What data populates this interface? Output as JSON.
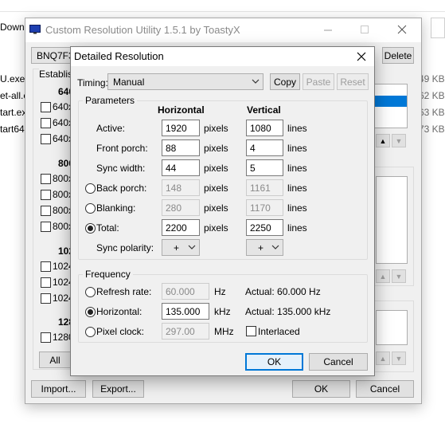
{
  "explorer": {
    "title_fragment": "Downlc",
    "files": [
      "U.exe",
      "et-all.e",
      "tart.ex",
      "tart64."
    ],
    "sizes": [
      "49 KB",
      "62 KB",
      "63 KB",
      "73 KB"
    ]
  },
  "main_window": {
    "title": "Custom Resolution Utility 1.5.1 by ToastyX",
    "monitor_combo": "BNQ7F33",
    "delete_label": "Delete",
    "established_label": "Establish",
    "res_group_a": "640",
    "res_list_a": [
      "640x",
      "640x",
      "640x"
    ],
    "res_group_b": "800",
    "res_list_b": [
      "800x",
      "800x",
      "800x",
      "800x"
    ],
    "res_group_c": "102",
    "res_list_c": [
      "1024",
      "1024",
      "1024"
    ],
    "res_group_d": "128",
    "res_list_d": [
      "1280"
    ],
    "all_label": "All",
    "import_label": "Import...",
    "export_label": "Export...",
    "ok_label": "OK",
    "cancel_label": "Cancel"
  },
  "dialog": {
    "title": "Detailed Resolution",
    "timing_label": "Timing:",
    "timing_value": "Manual",
    "copy_label": "Copy",
    "paste_label": "Paste",
    "reset_label": "Reset",
    "parameters_label": "Parameters",
    "horizontal_header": "Horizontal",
    "vertical_header": "Vertical",
    "rows": [
      {
        "label": "Active:",
        "h": "1920",
        "h_unit": "pixels",
        "v": "1080",
        "v_unit": "lines"
      },
      {
        "label": "Front porch:",
        "h": "88",
        "h_unit": "pixels",
        "v": "4",
        "v_unit": "lines"
      },
      {
        "label": "Sync width:",
        "h": "44",
        "h_unit": "pixels",
        "v": "5",
        "v_unit": "lines"
      },
      {
        "label": "Back porch:",
        "h": "148",
        "h_unit": "pixels",
        "v": "1161",
        "v_unit": "lines"
      },
      {
        "label": "Blanking:",
        "h": "280",
        "h_unit": "pixels",
        "v": "1170",
        "v_unit": "lines"
      },
      {
        "label": "Total:",
        "h": "2200",
        "h_unit": "pixels",
        "v": "2250",
        "v_unit": "lines"
      }
    ],
    "sync_polarity_label": "Sync polarity:",
    "h_polarity": "+",
    "v_polarity": "+",
    "frequency_label": "Frequency",
    "refresh_label": "Refresh rate:",
    "refresh_value": "60.000",
    "refresh_unit": "Hz",
    "refresh_actual": "Actual: 60.000 Hz",
    "horizontal_label": "Horizontal:",
    "horizontal_value": "135.000",
    "horizontal_unit": "kHz",
    "horizontal_actual": "Actual: 135.000 kHz",
    "pixel_clock_label": "Pixel clock:",
    "pixel_clock_value": "297.00",
    "pixel_clock_unit": "MHz",
    "interlaced_label": "Interlaced",
    "ok_label": "OK",
    "cancel_label": "Cancel"
  },
  "colors": {
    "accent": "#0078d7",
    "list_selection": "#0078d7",
    "window_bg": "#f0f0f0"
  }
}
